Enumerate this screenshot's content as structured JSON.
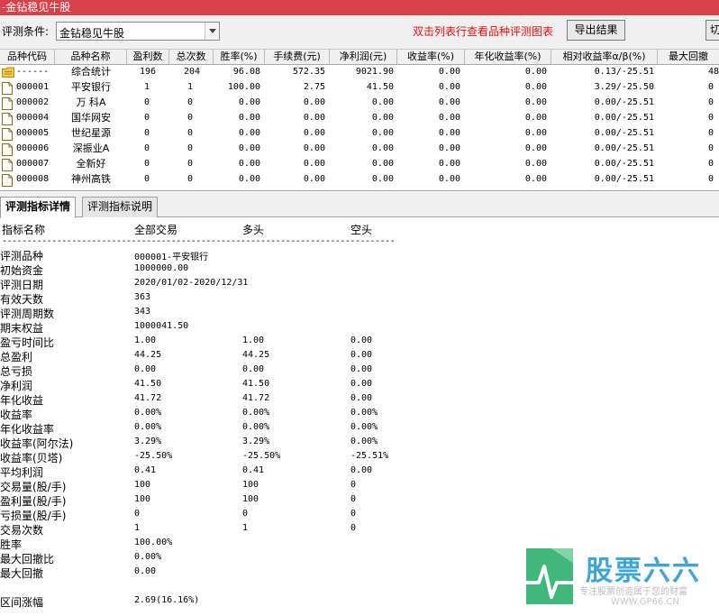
{
  "window": {
    "title": "-金钻稳见牛股"
  },
  "toolbar": {
    "condition_label": "评测条件:",
    "condition_value": "金钻稳见牛股",
    "hint": "双击列表行查看品种评测图表",
    "export_label": "导出结果",
    "cut_label": "切"
  },
  "grid": {
    "columns": [
      "品种代码",
      "品种名称",
      "盈利数",
      "总次数",
      "胜率(%)",
      "手续费(元)",
      "净利润(元)",
      "收益率(%)",
      "年化收益率(%)",
      "相对收益率α/β(%)",
      "最大回撤"
    ],
    "rows": [
      {
        "code": "------",
        "name": "综合统计",
        "wins": "196",
        "total": "204",
        "winrate": "96.08",
        "fee": "572.35",
        "profit": "9021.90",
        "ret": "0.00",
        "annual": "0.00",
        "relative": "0.13/-25.51",
        "drawdown": "48",
        "icon": "folder-icon"
      },
      {
        "code": "000001",
        "name": "平安银行",
        "wins": "1",
        "total": "1",
        "winrate": "100.00",
        "fee": "2.75",
        "profit": "41.50",
        "ret": "0.00",
        "annual": "0.00",
        "relative": "3.29/-25.50",
        "drawdown": "0",
        "icon": "document-icon"
      },
      {
        "code": "000002",
        "name": "万 科A",
        "wins": "0",
        "total": "0",
        "winrate": "0.00",
        "fee": "0.00",
        "profit": "0.00",
        "ret": "0.00",
        "annual": "0.00",
        "relative": "0.00/-25.51",
        "drawdown": "0",
        "icon": "document-icon"
      },
      {
        "code": "000004",
        "name": "国华网安",
        "wins": "0",
        "total": "0",
        "winrate": "0.00",
        "fee": "0.00",
        "profit": "0.00",
        "ret": "0.00",
        "annual": "0.00",
        "relative": "0.00/-25.51",
        "drawdown": "0",
        "icon": "document-icon"
      },
      {
        "code": "000005",
        "name": "世纪星源",
        "wins": "0",
        "total": "0",
        "winrate": "0.00",
        "fee": "0.00",
        "profit": "0.00",
        "ret": "0.00",
        "annual": "0.00",
        "relative": "0.00/-25.51",
        "drawdown": "0",
        "icon": "document-icon"
      },
      {
        "code": "000006",
        "name": "深振业A",
        "wins": "0",
        "total": "0",
        "winrate": "0.00",
        "fee": "0.00",
        "profit": "0.00",
        "ret": "0.00",
        "annual": "0.00",
        "relative": "0.00/-25.51",
        "drawdown": "0",
        "icon": "document-icon"
      },
      {
        "code": "000007",
        "name": "全新好",
        "wins": "0",
        "total": "0",
        "winrate": "0.00",
        "fee": "0.00",
        "profit": "0.00",
        "ret": "0.00",
        "annual": "0.00",
        "relative": "0.00/-25.51",
        "drawdown": "0",
        "icon": "document-icon"
      },
      {
        "code": "000008",
        "name": "神州高铁",
        "wins": "0",
        "total": "0",
        "winrate": "0.00",
        "fee": "0.00",
        "profit": "0.00",
        "ret": "0.00",
        "annual": "0.00",
        "relative": "0.00/-25.51",
        "drawdown": "0",
        "icon": "document-icon"
      }
    ]
  },
  "tabs": {
    "detail": "评测指标详情",
    "explain": "评测指标说明"
  },
  "detail": {
    "headers": {
      "name": "指标名称",
      "all": "全部交易",
      "long": "多头",
      "short": "空头"
    },
    "separator": "--------------------------------------------------------------------------------",
    "rows": [
      {
        "label": "评测品种",
        "all": "000001-平安银行",
        "long": "",
        "short": ""
      },
      {
        "label": "初始资金",
        "all": "1000000.00",
        "long": "",
        "short": ""
      },
      {
        "label": "评测日期",
        "all": "2020/01/02-2020/12/31",
        "long": "",
        "short": ""
      },
      {
        "label": "有效天数",
        "all": "363",
        "long": "",
        "short": ""
      },
      {
        "label": "评测周期数",
        "all": "343",
        "long": "",
        "short": ""
      },
      {
        "label": "期末权益",
        "all": "1000041.50",
        "long": "",
        "short": ""
      },
      {
        "label": "盈亏时间比",
        "all": "1.00",
        "long": "1.00",
        "short": "0.00"
      },
      {
        "label": "总盈利",
        "all": "44.25",
        "long": "44.25",
        "short": "0.00"
      },
      {
        "label": "总亏损",
        "all": "0.00",
        "long": "0.00",
        "short": "0.00"
      },
      {
        "label": "净利润",
        "all": "41.50",
        "long": "41.50",
        "short": "0.00"
      },
      {
        "label": "年化收益",
        "all": "41.72",
        "long": "41.72",
        "short": "0.00"
      },
      {
        "label": "收益率",
        "all": "0.00%",
        "long": "0.00%",
        "short": "0.00%"
      },
      {
        "label": "年化收益率",
        "all": "0.00%",
        "long": "0.00%",
        "short": "0.00%"
      },
      {
        "label": "收益率(阿尔法)",
        "all": "3.29%",
        "long": "3.29%",
        "short": "0.00%"
      },
      {
        "label": "收益率(贝塔)",
        "all": "-25.50%",
        "long": "-25.50%",
        "short": "-25.51%"
      },
      {
        "label": "平均利润",
        "all": "0.41",
        "long": "0.41",
        "short": "0.00"
      },
      {
        "label": "交易量(股/手)",
        "all": "100",
        "long": "100",
        "short": "0"
      },
      {
        "label": "盈利量(股/手)",
        "all": "100",
        "long": "100",
        "short": "0"
      },
      {
        "label": "亏损量(股/手)",
        "all": "0",
        "long": "0",
        "short": "0"
      },
      {
        "label": "交易次数",
        "all": "1",
        "long": "1",
        "short": "0"
      },
      {
        "label": "胜率",
        "all": "100.00%",
        "long": "",
        "short": ""
      },
      {
        "label": "最大回撤比",
        "all": "0.00%",
        "long": "",
        "short": ""
      },
      {
        "label": "最大回撤",
        "all": "0.00",
        "long": "",
        "short": ""
      },
      {
        "label": "",
        "all": "",
        "long": "",
        "short": ""
      },
      {
        "label": "区间涨幅",
        "all": "2.69(16.16%)",
        "long": "",
        "short": ""
      }
    ]
  },
  "watermark": {
    "title": "股票六六",
    "subtitle": "专注股票创造属于您的财富",
    "url": "WWW.GP66.CN",
    "logo": "gp66-logo-icon"
  },
  "colors": {
    "titlebar": "#d9404a",
    "hint": "#e01010",
    "watermark": "#3ea5d6"
  }
}
